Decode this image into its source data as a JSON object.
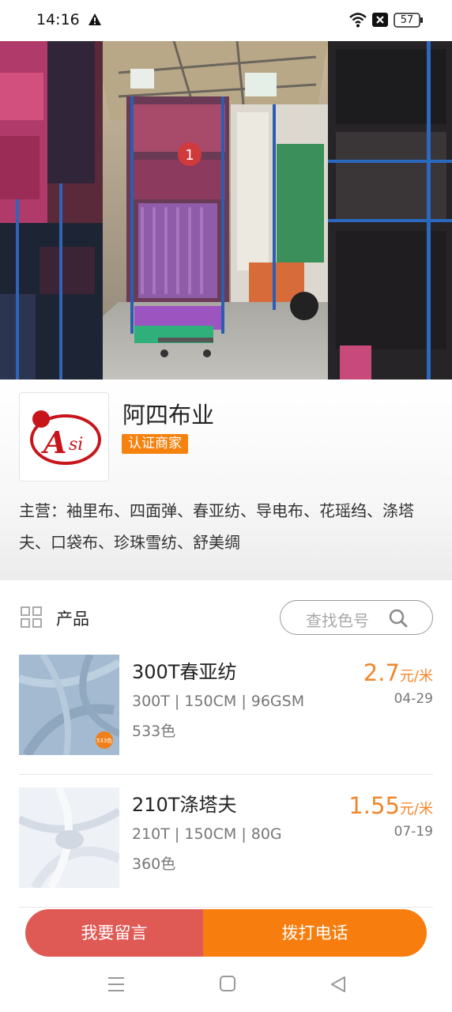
{
  "status_bar": {
    "time": "14:16",
    "battery": "57",
    "icons": [
      "warning-icon",
      "wifi-icon",
      "notification-x-icon",
      "battery-icon"
    ]
  },
  "shop": {
    "name": "阿四布业",
    "badge": "认证商家",
    "logo_text": "Asi",
    "main_business": "主营：袖里布、四面弹、春亚纺、导电布、花瑶绉、涤塔夫、口袋布、珍珠雪纺、舒美绸"
  },
  "products_header": {
    "title": "产品",
    "search_placeholder": "查找色号"
  },
  "products": [
    {
      "name": "300T春亚纺",
      "spec": "300T | 150CM | 96GSM",
      "colors": "533色",
      "price": "2.7",
      "unit": "元/米",
      "date": "04-29",
      "thumb_badge": "533色",
      "thumb_color": "#9fb6cc"
    },
    {
      "name": "210T涤塔夫",
      "spec": "210T | 150CM | 80G",
      "colors": "360色",
      "price": "1.55",
      "unit": "元/米",
      "date": "07-19",
      "thumb_color": "#eef1f6"
    }
  ],
  "actions": {
    "message": "我要留言",
    "call": "拨打电话"
  },
  "colors": {
    "accent_orange": "#f77d0f",
    "message_red": "#e05a55",
    "price_orange": "#f0862a",
    "badge_orange": "#f5820f"
  }
}
